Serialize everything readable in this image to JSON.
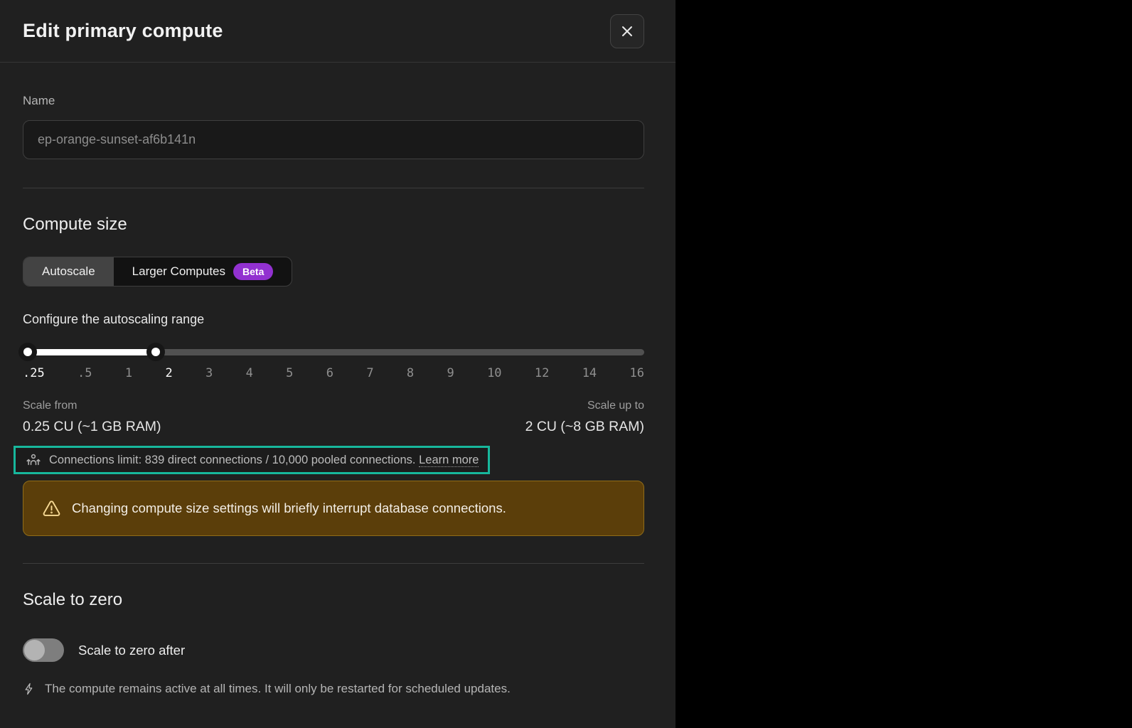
{
  "panel": {
    "title": "Edit primary compute"
  },
  "name_section": {
    "label": "Name",
    "placeholder": "ep-orange-sunset-af6b141n",
    "value": ""
  },
  "compute_size": {
    "heading": "Compute size",
    "tabs": [
      {
        "label": "Autoscale",
        "active": true
      },
      {
        "label": "Larger Computes",
        "badge": "Beta",
        "active": false
      }
    ],
    "slider": {
      "label": "Configure the autoscaling range",
      "ticks": [
        ".25",
        ".5",
        "1",
        "2",
        "3",
        "4",
        "5",
        "6",
        "7",
        "8",
        "9",
        "10",
        "12",
        "14",
        "16"
      ],
      "selected_min": ".25",
      "selected_max": "2",
      "fill_percent": 21.43
    },
    "scale_from": {
      "label": "Scale from",
      "value": "0.25 CU (~1 GB RAM)"
    },
    "scale_up_to": {
      "label": "Scale up to",
      "value": "2 CU (~8 GB RAM)"
    },
    "connections_note": {
      "text": "Connections limit: 839 direct connections / 10,000 pooled connections.",
      "link_label": "Learn more"
    },
    "warning_text": "Changing compute size settings will briefly interrupt database connections."
  },
  "scale_to_zero": {
    "heading": "Scale to zero",
    "toggle_label": "Scale to zero after",
    "toggle_on": false,
    "info_text": "The compute remains active at all times. It will only be restarted for scheduled updates."
  },
  "colors": {
    "annotation_teal": "#17b79c",
    "beta_badge_purple": "#9231d0",
    "warning_background": "#5b3e0a",
    "warning_border": "#916d18",
    "warning_icon": "#f7d994",
    "panel_background": "#202020",
    "slider_fill": "#ffffff"
  },
  "icons": {
    "close": "close-icon",
    "connections": "connections-icon",
    "warning": "warning-triangle-icon",
    "bolt": "lightning-bolt-icon"
  }
}
